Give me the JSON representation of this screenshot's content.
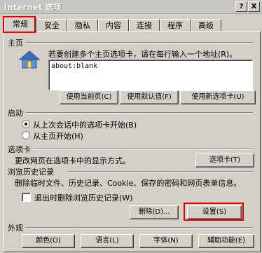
{
  "window": {
    "title": "Internet 选项",
    "help_button": "?",
    "close_button": "X"
  },
  "tabs": [
    {
      "label": "常规"
    },
    {
      "label": "安全"
    },
    {
      "label": "隐私"
    },
    {
      "label": "内容"
    },
    {
      "label": "连接"
    },
    {
      "label": "程序"
    },
    {
      "label": "高级"
    }
  ],
  "homepage": {
    "section_label": "主页",
    "instruction": "若要创建多个主页选项卡，请在每行输入一个地址(R)。",
    "address": "about:blank",
    "use_current": "使用当前页(C)",
    "use_default": "使用默认值(F)",
    "use_new_tab": "使用新选项卡(U)"
  },
  "startup": {
    "section_label": "启动",
    "option_last_session": "从上次会话中的选项卡开始(B)",
    "option_homepage": "从主页开始(H)"
  },
  "tabs_section": {
    "section_label": "选项卡",
    "description": "更改网页在选项卡中的显示方式。",
    "tabs_button": "选项卡(T)"
  },
  "history": {
    "section_label": "浏览历史记录",
    "description": "删除临时文件、历史记录、Cookie、保存的密码和网页表单信息。",
    "delete_on_exit": "退出时删除浏览历史记录(W)",
    "delete_button": "删除(D)...",
    "settings_button": "设置(S)"
  },
  "appearance": {
    "section_label": "外观",
    "colors_button": "颜色(O)",
    "languages_button": "语言(L)",
    "fonts_button": "字体(N)",
    "accessibility_button": "辅助功能(E)"
  },
  "colors": {
    "highlight": "#e00000",
    "dialog_bg": "#d4d0c8"
  }
}
